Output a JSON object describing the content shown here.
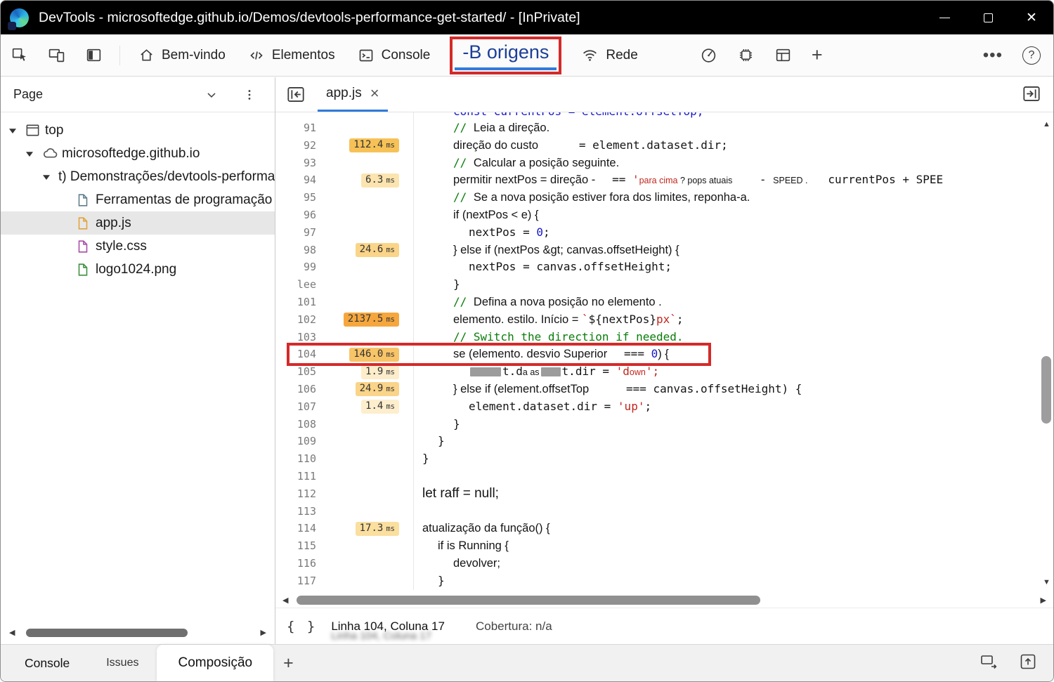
{
  "colors": {
    "annotation_red": "#d42a2a",
    "accent_blue": "#2f7bdc"
  },
  "titlebar": {
    "title": "DevTools - microsoftedge.github.io/Demos/devtools-performance-get-started/ - [InPrivate]"
  },
  "toolbar": {
    "icon_buttons": [
      "inspect-icon",
      "device-emulation-icon",
      "dock-panel-icon"
    ],
    "tabs": [
      {
        "label": "Bem-vindo",
        "icon": "home-icon"
      },
      {
        "label": "Elementos",
        "icon": "elements-icon"
      },
      {
        "label": "Console",
        "icon": "console-icon"
      },
      {
        "label": "-B origens",
        "active": true,
        "annotated": true
      },
      {
        "label": "Rede",
        "icon": "network-icon"
      }
    ],
    "right_icons": [
      "performance-icon",
      "memory-icon",
      "application-icon",
      "add-icon",
      "more-icon",
      "help-icon"
    ]
  },
  "sidebar": {
    "header": "Page",
    "tree": [
      {
        "label": "top",
        "indent": 0,
        "expander": true,
        "icon": "frame"
      },
      {
        "label": "microsoftedge.github.io",
        "indent": 1,
        "expander": true,
        "icon": "cloud"
      },
      {
        "label": "t) Demonstrações/devtools-performanc",
        "indent": 2,
        "expander": true
      },
      {
        "label": "Ferramentas de programação",
        "indent": 3,
        "icon": "doc",
        "color": "#5f7d8c"
      },
      {
        "label": "app.js",
        "indent": 3,
        "icon": "doc",
        "color": "#e2a33a",
        "selected": true
      },
      {
        "label": "style.css",
        "indent": 3,
        "icon": "doc",
        "color": "#a64ca6"
      },
      {
        "label": "logo1024.png",
        "indent": 3,
        "icon": "doc",
        "color": "#3d8f3d"
      }
    ]
  },
  "editor": {
    "tab": "app.js",
    "badge_unit": "ms",
    "status": {
      "braces": "{ }",
      "position": "Linha 104, Coluna 17",
      "coverage": "Cobertura: n/a"
    },
    "lines": [
      {
        "partial": true,
        "num": "",
        "ind": 2,
        "segs": [
          {
            "t": "const currentPos = element.offsetTop;",
            "c": "m blu"
          }
        ]
      },
      {
        "num": "91",
        "ind": 2,
        "segs": [
          {
            "t": "// ",
            "c": "m grn"
          },
          {
            "t": "Leia a direção.",
            "c": "s blk"
          }
        ]
      },
      {
        "num": "92",
        "badge": {
          "v": "112.4",
          "bg": "#f6c257"
        },
        "ind": 2,
        "segs": [
          {
            "t": "direção do custo",
            "c": "s blk"
          },
          {
            "t": "      = element.dataset.dir;",
            "c": "m blk"
          }
        ]
      },
      {
        "num": "93",
        "ind": 2,
        "segs": [
          {
            "t": "// ",
            "c": "m grn"
          },
          {
            "t": "Calcular a posição seguinte.",
            "c": "s blk"
          }
        ]
      },
      {
        "num": "94",
        "badge": {
          "v": "6.3",
          "bg": "#fbe4af"
        },
        "ind": 2,
        "segs": [
          {
            "t": "permitir nextPos = ",
            "c": "s blk"
          },
          {
            "t": "direção - ",
            "c": "s blk"
          },
          {
            "t": "  == ",
            "c": "m blk"
          },
          {
            "t": "'",
            "c": "m red"
          },
          {
            "t": "para cima",
            "c": "s red sm"
          },
          {
            "t": " ? ",
            "c": "s blk sm"
          },
          {
            "t": "pops atuais",
            "c": "s blk sm"
          },
          {
            "t": "    - ",
            "c": "m blk"
          },
          {
            "t": "SPEED .",
            "c": "s blk sm"
          },
          {
            "t": "   currentPos + SPEE",
            "c": "m blk"
          }
        ]
      },
      {
        "num": "95",
        "ind": 2,
        "segs": [
          {
            "t": "// ",
            "c": "m grn"
          },
          {
            "t": "Se a nova posição estiver fora dos limites, reponha-a.",
            "c": "s blk"
          }
        ]
      },
      {
        "num": "96",
        "ind": 2,
        "segs": [
          {
            "t": "if (nextPos < e) {",
            "c": "s blk"
          }
        ]
      },
      {
        "num": "97",
        "ind": 3,
        "segs": [
          {
            "t": "nextPos = ",
            "c": "m blk"
          },
          {
            "t": "0",
            "c": "m blu"
          },
          {
            "t": ";",
            "c": "m blk"
          }
        ]
      },
      {
        "num": "98",
        "badge": {
          "v": "24.6",
          "bg": "#fad488"
        },
        "ind": 2,
        "segs": [
          {
            "t": "} else if (nextPos &gt; canvas.offsetHeight) {",
            "c": "s blk"
          }
        ]
      },
      {
        "num": "99",
        "ind": 3,
        "segs": [
          {
            "t": "nextPos = canvas.offsetHeight;",
            "c": "m blk"
          }
        ]
      },
      {
        "num": "lee",
        "ind": 2,
        "segs": [
          {
            "t": "}",
            "c": "m blk"
          }
        ]
      },
      {
        "num": "101",
        "ind": 2,
        "segs": [
          {
            "t": "// ",
            "c": "m grn"
          },
          {
            "t": "Defina a nova posição no elemento .",
            "c": "s blk"
          }
        ]
      },
      {
        "num": "102",
        "badge": {
          "v": "2137.5",
          "bg": "#f5a73e"
        },
        "ind": 2,
        "segs": [
          {
            "t": "elemento. estilo. Início = ",
            "c": "s blk"
          },
          {
            "t": "`",
            "c": "m red"
          },
          {
            "t": "${nextPos}",
            "c": "m blk"
          },
          {
            "t": "px",
            "c": "m red"
          },
          {
            "t": "`",
            "c": "m red"
          },
          {
            "t": ";",
            "c": "m blk"
          }
        ]
      },
      {
        "num": "103",
        "ind": 2,
        "segs": [
          {
            "t": "// Switch the direction if needed.",
            "c": "m grn"
          }
        ]
      },
      {
        "num": "104",
        "boxed": true,
        "badge": {
          "v": "146.0",
          "bg": "#f8c468"
        },
        "ind": 2,
        "segs": [
          {
            "t": "se (elemento. desvio Superior ",
            "c": "s blk"
          },
          {
            "t": "  === ",
            "c": "m blk"
          },
          {
            "t": "0",
            "c": "m blu"
          },
          {
            "t": ") {",
            "c": "s blk"
          }
        ]
      },
      {
        "num": "105",
        "badge": {
          "v": "1.9",
          "bg": "#fdedca"
        },
        "ind": 3,
        "segs": [
          {
            "r": 44
          },
          {
            "t": "t.d",
            "c": "m blk"
          },
          {
            "t": "a as",
            "c": "s blk sm"
          },
          {
            "r": 28
          },
          {
            "t": "t.dir = ",
            "c": "m blk"
          },
          {
            "t": "'d",
            "c": "m red"
          },
          {
            "t": "own",
            "c": "s red sm"
          },
          {
            "t": "';",
            "c": "m red"
          }
        ]
      },
      {
        "num": "106",
        "badge": {
          "v": "24.9",
          "bg": "#fad488"
        },
        "ind": 2,
        "segs": [
          {
            "t": "} else if (element.offsetTop ",
            "c": "s blk"
          },
          {
            "t": "     === canvas.offsetHeight) {",
            "c": "m blk"
          }
        ]
      },
      {
        "num": "107",
        "badge": {
          "v": "1.4",
          "bg": "#fdeecd"
        },
        "ind": 3,
        "segs": [
          {
            "t": "element.dataset.dir = ",
            "c": "m blk"
          },
          {
            "t": "'up'",
            "c": "m red"
          },
          {
            "t": ";",
            "c": "m blk"
          }
        ]
      },
      {
        "num": "108",
        "ind": 2,
        "segs": [
          {
            "t": "}",
            "c": "m blk"
          }
        ]
      },
      {
        "num": "109",
        "ind": 1,
        "segs": [
          {
            "t": "}",
            "c": "m blk"
          }
        ]
      },
      {
        "num": "110",
        "ind": 0,
        "segs": [
          {
            "t": "}",
            "c": "m blk"
          }
        ]
      },
      {
        "num": "111",
        "ind": 0,
        "segs": []
      },
      {
        "num": "112",
        "ind": 0,
        "segs": [
          {
            "t": "let raff = null;",
            "c": "s blk lg"
          }
        ]
      },
      {
        "num": "113",
        "ind": 0,
        "segs": []
      },
      {
        "num": "114",
        "badge": {
          "v": "17.3",
          "bg": "#fbdf9f"
        },
        "ind": 0,
        "segs": [
          {
            "t": "atualização da função() {",
            "c": "s blk"
          }
        ]
      },
      {
        "num": "115",
        "ind": 1,
        "segs": [
          {
            "t": "if is Running {",
            "c": "s blk"
          }
        ]
      },
      {
        "num": "116",
        "ind": 2,
        "segs": [
          {
            "t": "devolver;",
            "c": "s blk"
          }
        ]
      },
      {
        "num": "117",
        "ind": 1,
        "segs": [
          {
            "t": "}",
            "c": "m blk"
          }
        ]
      }
    ]
  },
  "drawer": {
    "tabs": [
      {
        "label": "Console"
      },
      {
        "label": "Issues"
      },
      {
        "label": "Composição",
        "active": true
      }
    ]
  }
}
